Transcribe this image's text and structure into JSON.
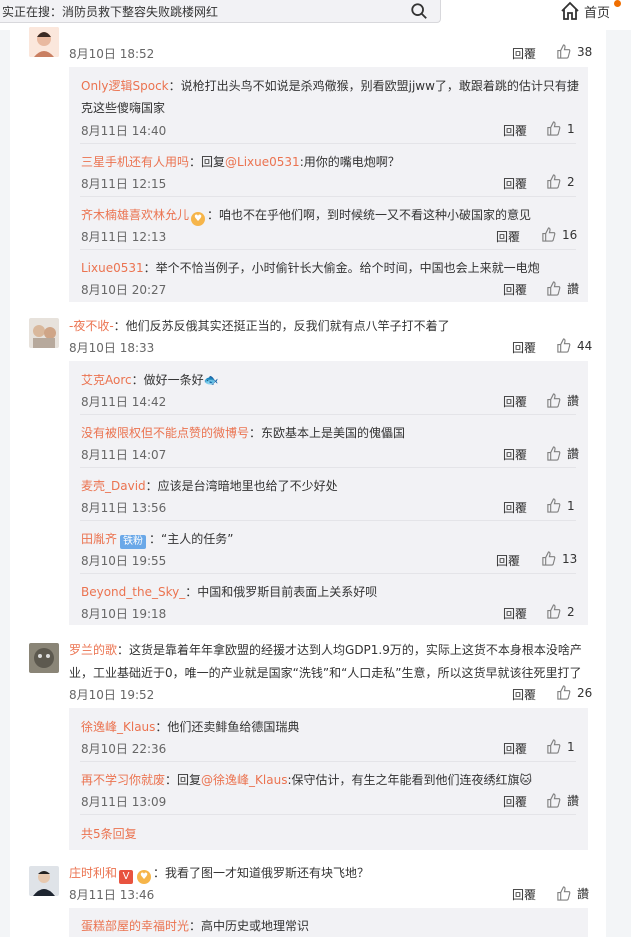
{
  "topbar": {
    "search_text": "实正在搜：消防员救下整容失败跳楼网红",
    "home_label": "首页"
  },
  "threads": [
    {
      "time": "8月10日 18:52",
      "reply": "回覆",
      "likes": "38",
      "subs": [
        {
          "user": "Only逻辑Spock",
          "text": "：说枪打出头鸟不如说是杀鸡儆猴，别看欧盟jjww了，敢跟着跳的估计只有捷",
          "text2": "克这些傻嗨国家",
          "time": "8月11日 14:40",
          "reply": "回覆",
          "likes": "1"
        },
        {
          "user": "三星手机还有人用吗",
          "text": "：回复",
          "mention": "@Lixue0531",
          "text_after": ":用你的嘴电炮啊？",
          "time": "8月11日 12:15",
          "reply": "回覆",
          "likes": "2"
        },
        {
          "user": "齐木楠雄喜欢林允儿",
          "text": "：咱也不在乎他们啊，到时候统一又不看这种小破国家的意见",
          "time": "8月11日 12:13",
          "reply": "回覆",
          "likes": "16"
        },
        {
          "user": "Lixue0531",
          "text": "：举个不恰当例子，小时偷针长大偷金。给个时间，中国也会上来就一电炮",
          "time": "8月10日 20:27",
          "reply": "回覆",
          "likes": "讚"
        }
      ]
    },
    {
      "user": "-夜不收-",
      "text": "：他们反苏反俄其实还挺正当的，反我们就有点八竿子打不着了",
      "time": "8月10日 18:33",
      "reply": "回覆",
      "likes": "44",
      "subs": [
        {
          "user": "艾克Aorc",
          "text": "：做好一条好",
          "time": "8月11日 14:42",
          "reply": "回覆",
          "likes": "讚"
        },
        {
          "user": "没有被限权但不能点赞的微博号",
          "text": "：东欧基本上是美国的傀儡国",
          "time": "8月11日 14:07",
          "reply": "回覆",
          "likes": "讚"
        },
        {
          "user": "麦壳_David",
          "text": "：应该是台湾暗地里也给了不少好处",
          "time": "8月11日 13:56",
          "reply": "回覆",
          "likes": "1"
        },
        {
          "user": "田胤齐",
          "badge": "铁粉",
          "text": "：“主人的任务”",
          "time": "8月10日 19:55",
          "reply": "回覆",
          "likes": "13"
        },
        {
          "user": "Beyond_the_Sky_",
          "text": "：中国和俄罗斯目前表面上关系好呗",
          "time": "8月10日 19:18",
          "reply": "回覆",
          "likes": "2"
        }
      ]
    },
    {
      "user": "罗兰的歌",
      "text": "：这货是靠着年年拿欧盟的经援才达到人均GDP1.9万的，实际上这货不本身根本没啥产",
      "text2": "业，工业基础近于0，唯一的产业就是国家“洗钱”和“人口走私”生意，所以这货早就该往死里打了",
      "time": "8月10日 19:52",
      "reply": "回覆",
      "likes": "26",
      "subs": [
        {
          "user": "徐逸峰_Klaus",
          "text": "：他们还卖鲱鱼给德国瑞典",
          "time": "8月10日 22:36",
          "reply": "回覆",
          "likes": "1"
        },
        {
          "user": "再不学习你就废",
          "text": "：回复",
          "mention": "@徐逸峰_Klaus",
          "text_after": ":保守估计，有生之年能看到他们连夜绣红旗",
          "time": "8月11日 13:09",
          "reply": "回覆",
          "likes": "讚"
        }
      ],
      "more": "共5条回复"
    },
    {
      "user": "庄时利和",
      "text": "：我看了图一才知道俄罗斯还有块飞地？",
      "time": "8月11日 13:46",
      "reply": "回覆",
      "likes": "讚",
      "subs": [
        {
          "user": "蛋糕部屋的幸福时光",
          "text": "：高中历史或地理常识"
        }
      ]
    }
  ]
}
